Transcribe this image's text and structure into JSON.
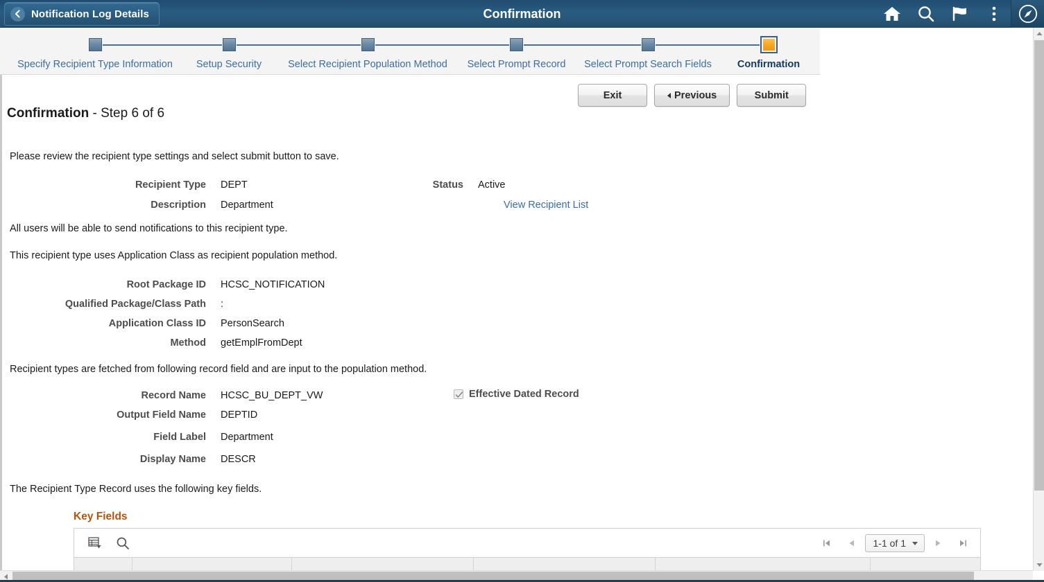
{
  "header": {
    "back_label": "Notification Log Details",
    "title": "Confirmation",
    "icons": [
      {
        "name": "home-icon",
        "label": "Home"
      },
      {
        "name": "search-icon",
        "label": "Search"
      },
      {
        "name": "flag-icon",
        "label": "Notifications"
      },
      {
        "name": "kebab-menu-icon",
        "label": "Actions"
      },
      {
        "name": "navbar-compass-icon",
        "label": "NavBar"
      }
    ],
    "bg_color": "#26567a",
    "text_color": "#ffffff"
  },
  "train": {
    "steps": [
      {
        "label": "Specify Recipient Type Information",
        "state": "complete"
      },
      {
        "label": "Setup Security",
        "state": "complete"
      },
      {
        "label": "Select Recipient Population Method",
        "state": "complete"
      },
      {
        "label": "Select Prompt Record",
        "state": "complete"
      },
      {
        "label": "Select Prompt Search Fields",
        "state": "complete"
      },
      {
        "label": "Confirmation",
        "state": "active"
      }
    ],
    "active_color": "#f6a623",
    "link_color": "#3a6ea5",
    "active_text_color": "#123a63"
  },
  "toolbar": {
    "exit_label": "Exit",
    "previous_label": "Previous",
    "submit_label": "Submit"
  },
  "page": {
    "title_bold": "Confirmation",
    "title_rest": "- Step 6 of 6",
    "instruction": "Please review the recipient type settings and select submit button to save.",
    "note_all_users": "All users will be able to send notifications to this recipient type.",
    "note_population": "This recipient type uses Application Class as recipient population method.",
    "note_record_field": "Recipient types are fetched from following record field and are input to the population method.",
    "note_key_fields": "The Recipient Type Record uses the following key fields."
  },
  "summary": {
    "recipient_type_label": "Recipient Type",
    "recipient_type_value": "DEPT",
    "description_label": "Description",
    "description_value": "Department",
    "status_label": "Status",
    "status_value": "Active",
    "view_recipient_list_link": "View Recipient List"
  },
  "appclass": {
    "root_package_label": "Root Package ID",
    "root_package_value": "HCSC_NOTIFICATION",
    "qualified_path_label": "Qualified Package/Class Path",
    "qualified_path_value": ":",
    "app_class_label": "Application Class ID",
    "app_class_value": "PersonSearch",
    "method_label": "Method",
    "method_value": "getEmplFromDept"
  },
  "record": {
    "record_name_label": "Record Name",
    "record_name_value": "HCSC_BU_DEPT_VW",
    "output_field_label": "Output Field Name",
    "output_field_value": "DEPTID",
    "field_label_label": "Field Label",
    "field_label_value": "Department",
    "display_name_label": "Display Name",
    "display_name_value": "DESCR",
    "effective_dated_label": "Effective Dated Record",
    "effective_dated_checked": true
  },
  "key_fields_grid": {
    "caption": "Key Fields",
    "caption_color": "#b1540e",
    "personalize_icon": "grid-personalize-icon",
    "find_icon": "grid-find-icon",
    "pager": {
      "first_label": "First",
      "previous_label": "Previous",
      "range_label": "1-1 of 1",
      "next_label": "Next",
      "last_label": "Last"
    },
    "columns": [
      "",
      "",
      "",
      "",
      "",
      ""
    ],
    "rows": []
  },
  "scrollbars": {
    "vertical_present": true,
    "horizontal_present": true
  }
}
